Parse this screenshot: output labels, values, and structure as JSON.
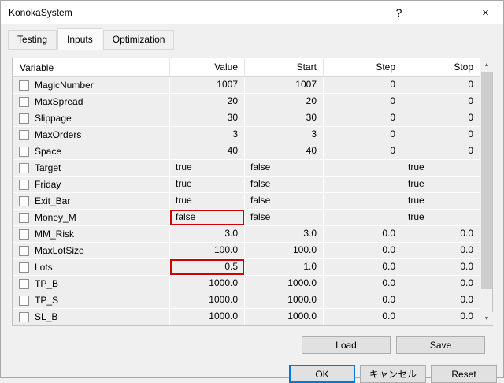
{
  "window": {
    "title": "KonokaSystem",
    "help_icon": "?",
    "close_icon": "×"
  },
  "tabs": [
    {
      "label": "Testing",
      "active": false
    },
    {
      "label": "Inputs",
      "active": true
    },
    {
      "label": "Optimization",
      "active": false
    }
  ],
  "table": {
    "headers": [
      "Variable",
      "Value",
      "Start",
      "Step",
      "Stop"
    ],
    "rows": [
      {
        "variable": "MagicNumber",
        "value": "1007",
        "start": "1007",
        "step": "0",
        "stop": "0"
      },
      {
        "variable": "MaxSpread",
        "value": "20",
        "start": "20",
        "step": "0",
        "stop": "0"
      },
      {
        "variable": "Slippage",
        "value": "30",
        "start": "30",
        "step": "0",
        "stop": "0"
      },
      {
        "variable": "MaxOrders",
        "value": "3",
        "start": "3",
        "step": "0",
        "stop": "0"
      },
      {
        "variable": "Space",
        "value": "40",
        "start": "40",
        "step": "0",
        "stop": "0"
      },
      {
        "variable": "Target",
        "value": "true",
        "start": "false",
        "step": "",
        "stop": "true"
      },
      {
        "variable": "Friday",
        "value": "true",
        "start": "false",
        "step": "",
        "stop": "true"
      },
      {
        "variable": "Exit_Bar",
        "value": "true",
        "start": "false",
        "step": "",
        "stop": "true"
      },
      {
        "variable": "Money_M",
        "value": "false",
        "start": "false",
        "step": "",
        "stop": "true",
        "value_highlighted": true
      },
      {
        "variable": "MM_Risk",
        "value": "3.0",
        "start": "3.0",
        "step": "0.0",
        "stop": "0.0"
      },
      {
        "variable": "MaxLotSize",
        "value": "100.0",
        "start": "100.0",
        "step": "0.0",
        "stop": "0.0"
      },
      {
        "variable": "Lots",
        "value": "0.5",
        "start": "1.0",
        "step": "0.0",
        "stop": "0.0",
        "value_highlighted": true
      },
      {
        "variable": "TP_B",
        "value": "1000.0",
        "start": "1000.0",
        "step": "0.0",
        "stop": "0.0"
      },
      {
        "variable": "TP_S",
        "value": "1000.0",
        "start": "1000.0",
        "step": "0.0",
        "stop": "0.0"
      },
      {
        "variable": "SL_B",
        "value": "1000.0",
        "start": "1000.0",
        "step": "0.0",
        "stop": "0.0"
      }
    ]
  },
  "scrollbar": {
    "up_icon": "▲",
    "down_icon": "▼"
  },
  "buttons": {
    "load": "Load",
    "save": "Save",
    "ok": "OK",
    "cancel": "キャンセル",
    "reset": "Reset"
  },
  "colors": {
    "highlight_border": "#d10000",
    "focus_border": "#0078d7"
  }
}
